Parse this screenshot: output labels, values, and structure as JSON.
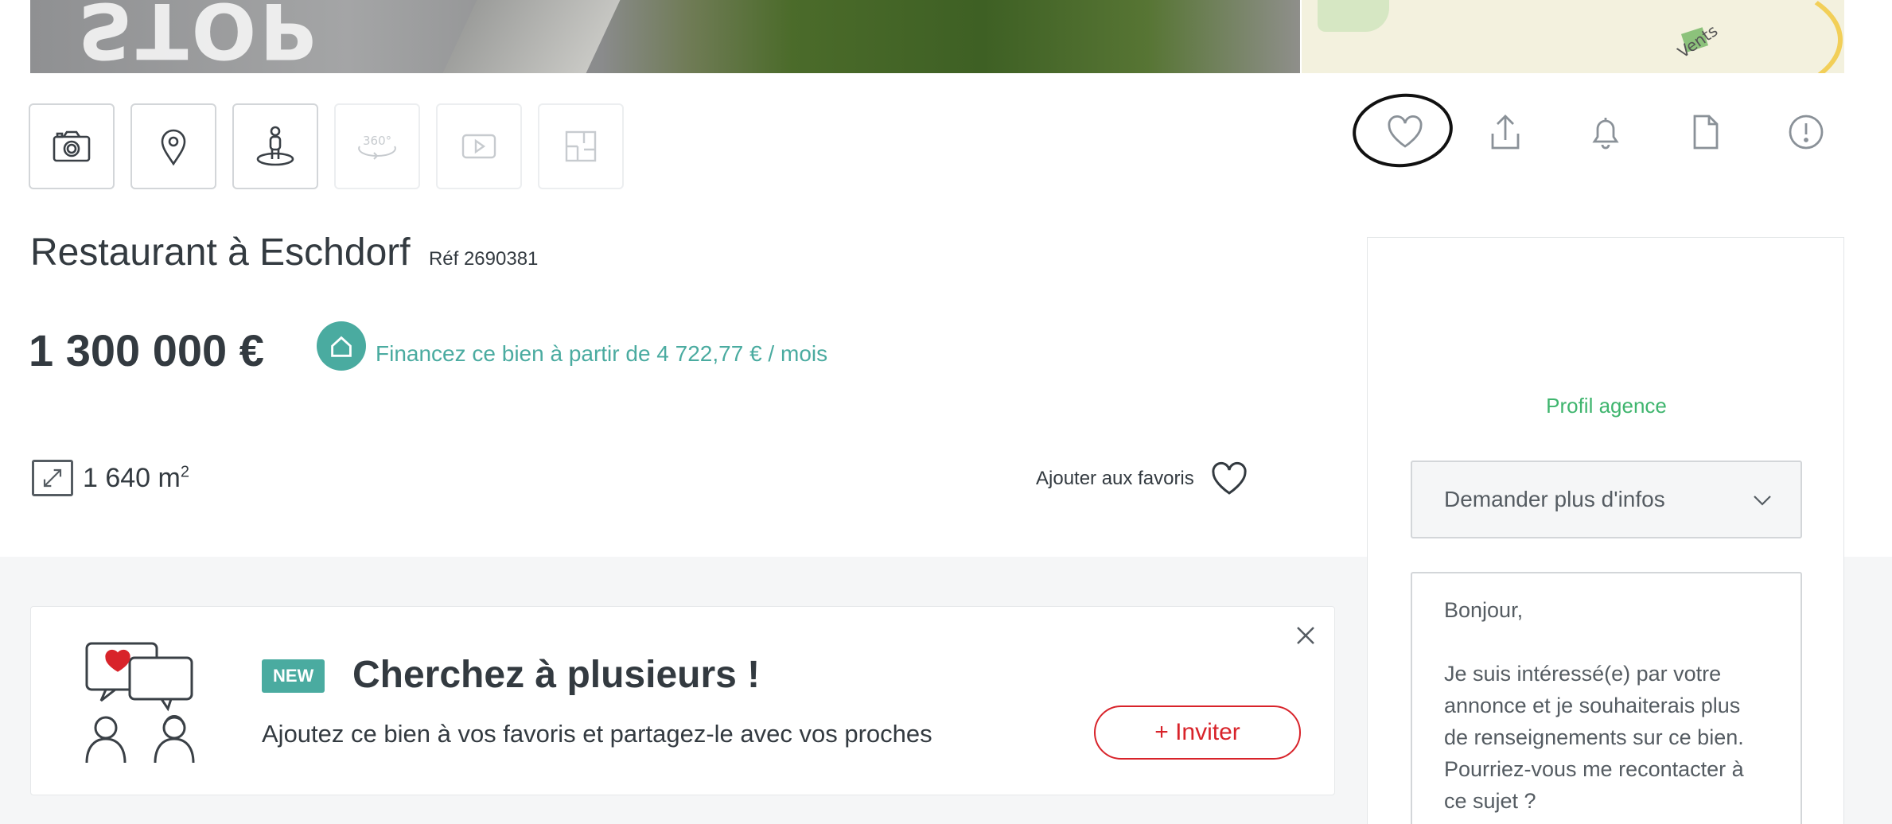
{
  "listing": {
    "title": "Restaurant à Eschdorf",
    "reference": "Réf 2690381",
    "price": "1 300 000 €",
    "financing_text": "Financez ce bien à partir de 4 722,77 € / mois",
    "area_value": "1 640 m",
    "area_unit_sup": "2",
    "add_favorites_label": "Ajouter aux favoris"
  },
  "photo": {
    "road_marking_text": "STOP"
  },
  "map": {
    "street_label": "Vents"
  },
  "media_buttons": [
    {
      "icon": "camera-icon",
      "enabled": true
    },
    {
      "icon": "map-pin-icon",
      "enabled": true
    },
    {
      "icon": "street-view-icon",
      "enabled": true
    },
    {
      "icon": "360-view-icon",
      "enabled": false,
      "label": "360°"
    },
    {
      "icon": "video-play-icon",
      "enabled": false
    },
    {
      "icon": "floor-plan-icon",
      "enabled": false
    }
  ],
  "action_icons": [
    "heart-icon",
    "share-icon",
    "bell-icon",
    "document-icon",
    "alert-icon"
  ],
  "promo": {
    "badge": "NEW",
    "heading": "Cherchez à plusieurs !",
    "text": "Ajoutez ce bien à vos favoris et partagez-le avec vos proches",
    "button_label": "+ Inviter"
  },
  "contact_panel": {
    "agency_profile_link": "Profil agence",
    "request_select_value": "Demander plus d'infos",
    "message_greeting": "Bonjour,",
    "message_body": "Je suis intéressé(e) par votre annonce et je souhaiterais plus de renseignements sur ce bien. Pourriez-vous me recontacter à ce sujet ?"
  },
  "colors": {
    "accent_teal": "#4aaba0",
    "agency_green": "#3fb56e",
    "invite_red": "#d8232a",
    "text_dark": "#333a40"
  }
}
